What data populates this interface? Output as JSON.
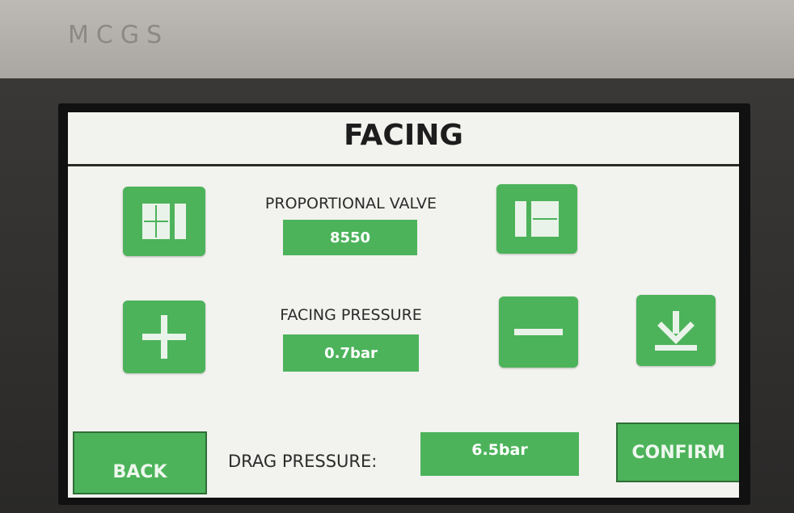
{
  "device": {
    "brand": "MCGS"
  },
  "screen": {
    "title": "FACING",
    "proportional_valve": {
      "label": "PROPORTIONAL VALVE",
      "value": "8550"
    },
    "facing_pressure": {
      "label": "FACING PRESSURE",
      "value": "0.7bar"
    },
    "drag_pressure": {
      "label": "DRAG PRESSURE:",
      "value": "6.5bar"
    },
    "buttons": {
      "back": "BACK",
      "confirm": "CONFIRM",
      "valve_left_icon": "panel-left-icon",
      "valve_right_icon": "panel-right-icon",
      "increase_icon": "plus-icon",
      "decrease_icon": "minus-icon",
      "download_icon": "download-icon"
    }
  },
  "colors": {
    "accent": "#4cb35a",
    "screen_bg": "#f2f2ef",
    "text": "#1d1d1d"
  }
}
